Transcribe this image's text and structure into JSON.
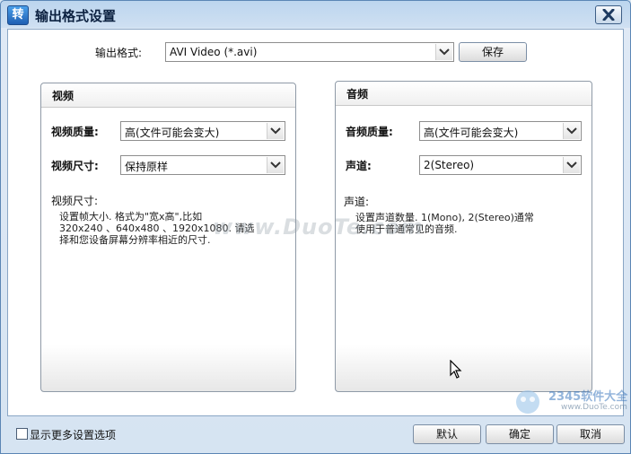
{
  "window": {
    "title": "输出格式设置",
    "app_icon_glyph": "转"
  },
  "format": {
    "label": "输出格式:",
    "value": "AVI Video (*.avi)",
    "save_label": "保存"
  },
  "video": {
    "title": "视频",
    "quality_label": "视频质量:",
    "quality_value": "高(文件可能会变大)",
    "size_label": "视频尺寸:",
    "size_value": "保持原样",
    "desc_title": "视频尺寸:",
    "desc_lines": [
      "设置帧大小. 格式为\"宽x高\",比如",
      "320x240 、640x480 、1920x1080. 请选",
      "择和您设备屏幕分辨率相近的尺寸."
    ]
  },
  "audio": {
    "title": "音频",
    "quality_label": "音频质量:",
    "quality_value": "高(文件可能会变大)",
    "channel_label": "声道:",
    "channel_value": "2(Stereo)",
    "desc_title": "声道:",
    "desc_lines": [
      "设置声道数量. 1(Mono), 2(Stereo)通常",
      "使用于普通常见的音频."
    ]
  },
  "watermark_text": "www.DuoTe.com",
  "footer": {
    "more_options_label": "显示更多设置选项",
    "more_options_checked": false,
    "default_label": "默认",
    "ok_label": "确定",
    "cancel_label": "取消"
  },
  "brand": {
    "name": "2345软件大全",
    "url": "www.DuoTe.com"
  },
  "colors": {
    "title_bar": "#bcd5ee",
    "accent": "#1f5fb3",
    "border": "#5b86b5"
  }
}
